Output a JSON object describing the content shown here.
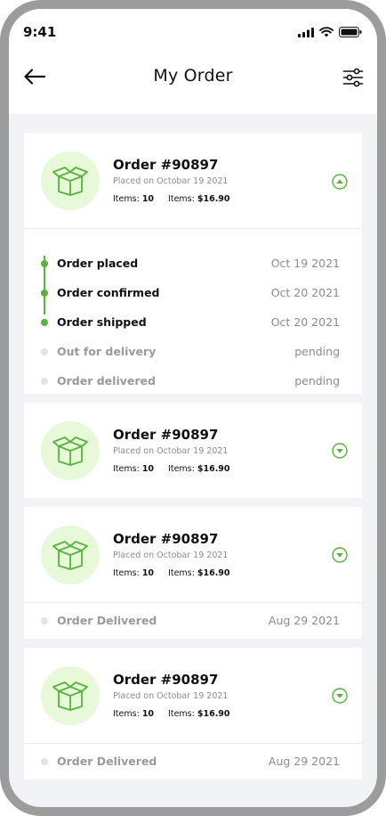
{
  "status_bar": {
    "time": "9:41"
  },
  "header": {
    "title": "My Order"
  },
  "colors": {
    "accent": "#57b33d",
    "accent_light": "#e7f9d8",
    "pending": "#e4e4e6",
    "background": "#f2f3f7"
  },
  "orders": [
    {
      "title": "Order #90897",
      "placed": "Placed on Octobar 19 2021",
      "items_label": "Items:",
      "items_count": "10",
      "price_label": "Items:",
      "price": "$16.90",
      "expanded": true,
      "timeline": [
        {
          "label": "Order placed",
          "date": "Oct 19 2021",
          "done": true
        },
        {
          "label": "Order confirmed",
          "date": "Oct 20 2021",
          "done": true
        },
        {
          "label": "Order shipped",
          "date": "Oct 20 2021",
          "done": true
        },
        {
          "label": "Out for delivery",
          "date": "pending",
          "done": false
        },
        {
          "label": "Order delivered",
          "date": "pending",
          "done": false
        }
      ]
    },
    {
      "title": "Order #90897",
      "placed": "Placed on Octobar 19 2021",
      "items_label": "Items:",
      "items_count": "10",
      "price_label": "Items:",
      "price": "$16.90",
      "expanded": false
    },
    {
      "title": "Order #90897",
      "placed": "Placed on Octobar 19 2021",
      "items_label": "Items:",
      "items_count": "10",
      "price_label": "Items:",
      "price": "$16.90",
      "expanded": false,
      "status": {
        "label": "Order Delivered",
        "date": "Aug 29 2021"
      }
    },
    {
      "title": "Order #90897",
      "placed": "Placed on Octobar 19 2021",
      "items_label": "Items:",
      "items_count": "10",
      "price_label": "Items:",
      "price": "$16.90",
      "expanded": false,
      "status": {
        "label": "Order Delivered",
        "date": "Aug 29 2021"
      }
    }
  ]
}
